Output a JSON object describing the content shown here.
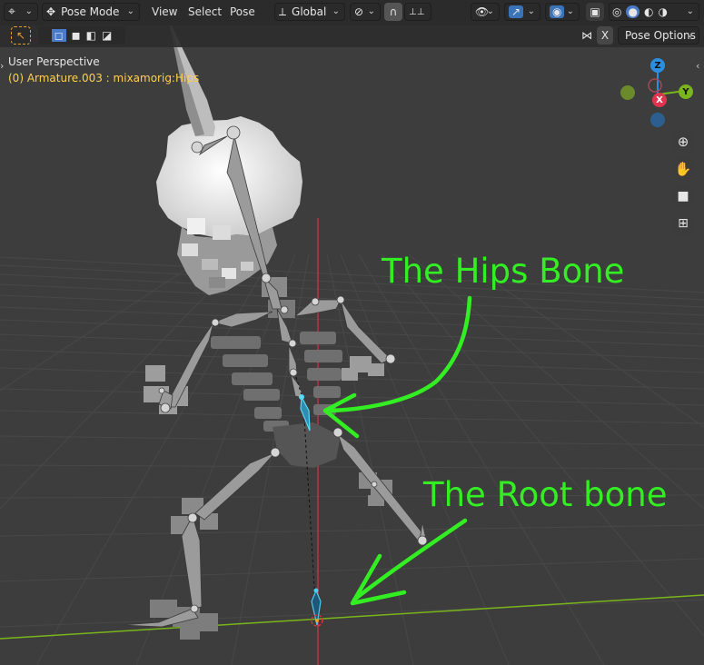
{
  "header": {
    "mode": "Pose Mode",
    "menus": [
      "View",
      "Select",
      "Pose"
    ],
    "orientation": "Global",
    "pose_options": "Pose Options",
    "x_mirror": "X"
  },
  "overlay": {
    "perspective": "User Perspective",
    "object_info": "(0) Armature.003 : mixamorig:Hips"
  },
  "gizmo": {
    "z": "Z",
    "y": "Y",
    "x": "X"
  },
  "annotations": {
    "hips": "The Hips Bone",
    "root": "The Root bone"
  },
  "colors": {
    "annotation": "#33ee22",
    "object_info": "#ffd04a",
    "selected_bone": "#47c8e8",
    "x_axis": "#e0334d",
    "y_axis": "#7ab51c",
    "z_axis": "#2a8fe0"
  },
  "icons": [
    "editor-type-icon",
    "pose-mode-icon",
    "transform-orientation-icon",
    "pivot-icon",
    "snap-icon",
    "proportional-icon",
    "visibility-icon",
    "gizmo-icon",
    "overlay-icon",
    "xray-icon",
    "wireframe-shading-icon",
    "solid-shading-icon",
    "material-shading-icon",
    "rendered-shading-icon",
    "zoom-icon",
    "pan-hand-icon",
    "camera-icon",
    "grid-ortho-icon"
  ]
}
